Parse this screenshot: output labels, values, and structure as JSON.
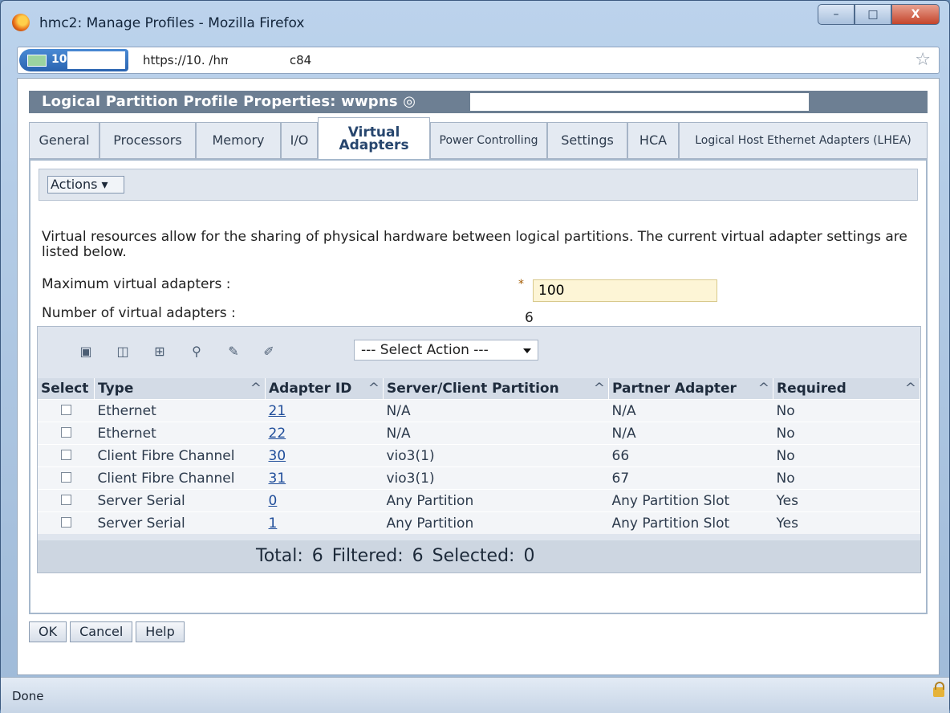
{
  "window": {
    "title": "hmc2: Manage Profiles - Mozilla Firefox",
    "controls": [
      "–",
      "□",
      "X"
    ]
  },
  "urlbar": {
    "site_label": "10.",
    "url": "https://10.           /hmc/wcl/T19c84"
  },
  "page": {
    "header": "Logical Partition Profile Properties: wwpns",
    "tabs": [
      {
        "label": "General"
      },
      {
        "label": "Processors"
      },
      {
        "label": "Memory"
      },
      {
        "label": "I/O"
      },
      {
        "label": "Virtual Adapters"
      },
      {
        "label": "Power Controlling"
      },
      {
        "label": "Settings"
      },
      {
        "label": "HCA"
      },
      {
        "label": "Logical Host Ethernet Adapters (LHEA)"
      }
    ],
    "actions_label": "Actions ▾",
    "description": "Virtual resources allow for the sharing of physical hardware between logical partitions. The current virtual adapter settings are listed below.",
    "max_label": "Maximum virtual adapters :",
    "max_value": "100",
    "num_label": "Number of virtual adapters :",
    "num_value": "6",
    "select_action": "--- Select Action ---",
    "columns": [
      "Select",
      "Type",
      "Adapter ID",
      "Server/Client Partition",
      "Partner Adapter",
      "Required"
    ],
    "rows": [
      {
        "type": "Ethernet",
        "id": "21",
        "partition": "N/A",
        "partner": "N/A",
        "required": "No"
      },
      {
        "type": "Ethernet",
        "id": "22",
        "partition": "N/A",
        "partner": "N/A",
        "required": "No"
      },
      {
        "type": "Client Fibre Channel",
        "id": "30",
        "partition": "vio3(1)",
        "partner": "66",
        "required": "No"
      },
      {
        "type": "Client Fibre Channel",
        "id": "31",
        "partition": "vio3(1)",
        "partner": "67",
        "required": "No"
      },
      {
        "type": "Server Serial",
        "id": "0",
        "partition": "Any Partition",
        "partner": "Any Partition Slot",
        "required": "Yes"
      },
      {
        "type": "Server Serial",
        "id": "1",
        "partition": "Any Partition",
        "partner": "Any Partition Slot",
        "required": "Yes"
      }
    ],
    "footer": "Total: 6   Filtered: 6   Selected: 0",
    "buttons": {
      "ok": "OK",
      "cancel": "Cancel",
      "help": "Help"
    }
  },
  "status": "Done",
  "icons": [
    "firefox-icon",
    "star-icon",
    "select-all-icon",
    "deselect-all-icon",
    "filter-icon",
    "clear-filter-icon",
    "edit-sort-icon",
    "clear-sort-icon",
    "lock-icon"
  ]
}
